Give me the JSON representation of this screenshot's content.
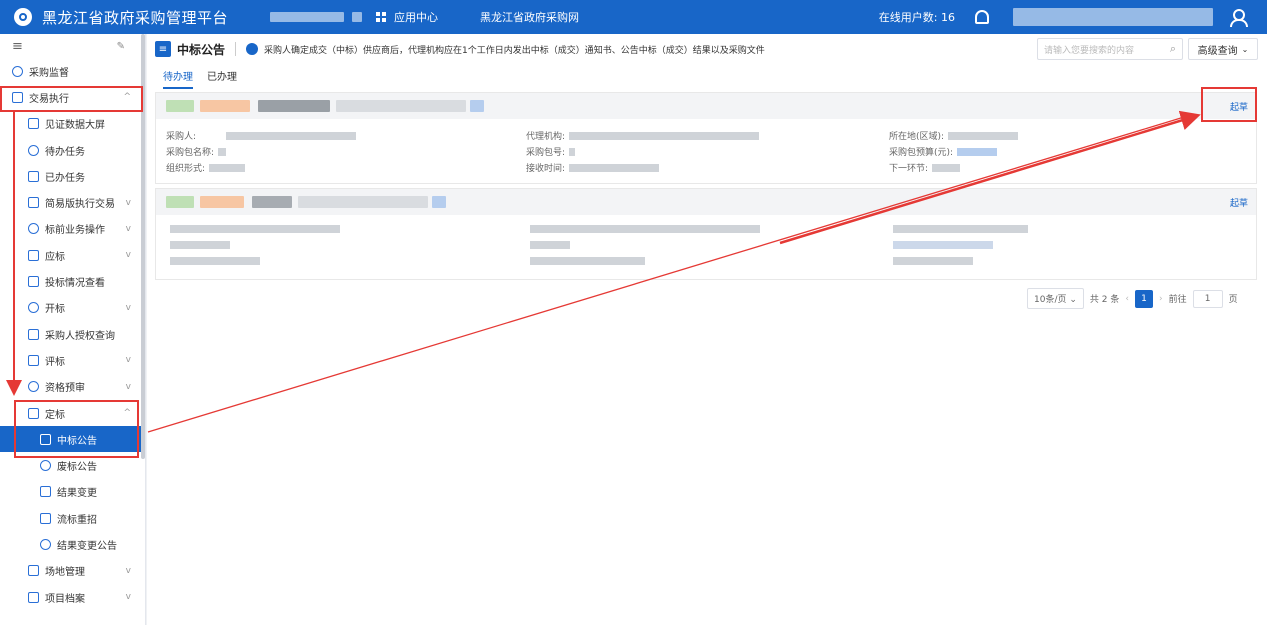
{
  "header": {
    "title": "黑龙江省政府采购管理平台",
    "app_center": "应用中心",
    "site_link": "黑龙江省政府采购网",
    "online_users_label": "在线用户数: 16"
  },
  "sidebar": {
    "items": [
      {
        "label": "采购监督",
        "level": 0,
        "expand": ""
      },
      {
        "label": "交易执行",
        "level": 0,
        "expand": "^"
      },
      {
        "label": "见证数据大屏",
        "level": 1,
        "expand": ""
      },
      {
        "label": "待办任务",
        "level": 1,
        "expand": ""
      },
      {
        "label": "已办任务",
        "level": 1,
        "expand": ""
      },
      {
        "label": "简易版执行交易",
        "level": 1,
        "expand": "v"
      },
      {
        "label": "标前业务操作",
        "level": 1,
        "expand": "v"
      },
      {
        "label": "应标",
        "level": 1,
        "expand": "v"
      },
      {
        "label": "投标情况查看",
        "level": 1,
        "expand": ""
      },
      {
        "label": "开标",
        "level": 1,
        "expand": "v"
      },
      {
        "label": "采购人授权查询",
        "level": 1,
        "expand": ""
      },
      {
        "label": "评标",
        "level": 1,
        "expand": "v"
      },
      {
        "label": "资格预审",
        "level": 1,
        "expand": "v"
      },
      {
        "label": "定标",
        "level": 1,
        "expand": "^"
      },
      {
        "label": "中标公告",
        "level": 2,
        "expand": ""
      },
      {
        "label": "废标公告",
        "level": 2,
        "expand": ""
      },
      {
        "label": "结果变更",
        "level": 2,
        "expand": ""
      },
      {
        "label": "流标重招",
        "level": 2,
        "expand": ""
      },
      {
        "label": "结果变更公告",
        "level": 2,
        "expand": ""
      },
      {
        "label": "场地管理",
        "level": 1,
        "expand": "v"
      },
      {
        "label": "项目档案",
        "level": 1,
        "expand": "v"
      }
    ]
  },
  "main": {
    "page_title": "中标公告",
    "notice": "采购人确定成交（中标）供应商后，代理机构应在1个工作日内发出中标（成交）通知书、公告中标（成交）结果以及采购文件",
    "search_placeholder": "请输入您要搜索的内容",
    "advanced_search": "高级查询",
    "tabs": [
      "待办理",
      "已办理"
    ],
    "card": {
      "draft": "起草",
      "purchaser": "采购人:",
      "agency": "代理机构:",
      "region": "所在地(区域):",
      "package_name": "采购包名称:",
      "package_no": "采购包号:",
      "budget": "采购包预算(元):",
      "org_form": "组织形式:",
      "receive_time": "接收时间:",
      "next_step": "下一环节:"
    },
    "card2_draft": "起草",
    "pager": {
      "page_size": "10条/页",
      "total": "共 2 条",
      "current": "1",
      "goto_label": "前往",
      "goto_value": "1",
      "page_unit": "页"
    }
  },
  "colors": {
    "primary": "#1866c8",
    "annotation": "#e53935"
  }
}
